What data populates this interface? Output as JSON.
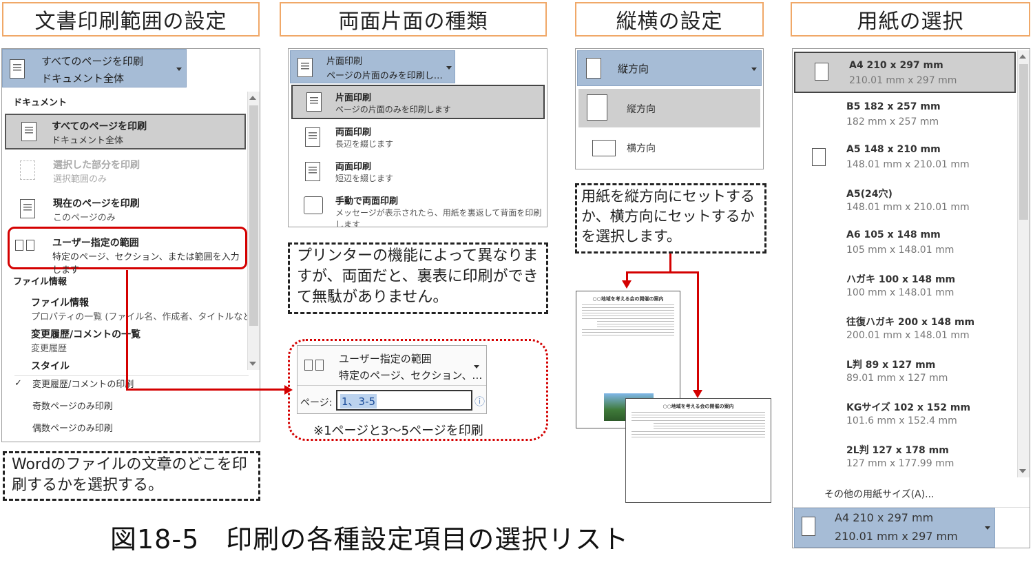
{
  "headers": {
    "h1": "文書印刷範囲の設定",
    "h2": "両面片面の種類",
    "h3": "縦横の設定",
    "h4": "用紙の選択"
  },
  "range_panel": {
    "selected_title": "すべてのページを印刷",
    "selected_sub": "ドキュメント全体",
    "group_document": "ドキュメント",
    "items": [
      {
        "title": "すべてのページを印刷",
        "sub": "ドキュメント全体"
      },
      {
        "title": "選択した部分を印刷",
        "sub": "選択範囲のみ"
      },
      {
        "title": "現在のページを印刷",
        "sub": "このページのみ"
      },
      {
        "title": "ユーザー指定の範囲",
        "sub": "特定のページ、セクション、または範囲を入力します"
      }
    ],
    "group_file": "ファイル情報",
    "file_items": [
      {
        "title": "ファイル情報",
        "sub": "プロパティの一覧 (ファイル名、作成者、タイトルなど)"
      },
      {
        "title": "変更履歴/コメントの一覧",
        "sub": "変更履歴"
      },
      {
        "title": "スタイル",
        "sub": ""
      }
    ],
    "check_items": [
      "変更履歴/コメントの印刷",
      "奇数ページのみ印刷",
      "偶数ページのみ印刷"
    ],
    "check_mark": "✓"
  },
  "range_note": "Wordのファイルの文章のどこを印刷するかを選択する。",
  "duplex_panel": {
    "selected_title": "片面印刷",
    "selected_sub": "ページの片面のみを印刷し…",
    "items": [
      {
        "title": "片面印刷",
        "sub": "ページの片面のみを印刷します"
      },
      {
        "title": "両面印刷",
        "sub": "長辺を綴じます"
      },
      {
        "title": "両面印刷",
        "sub": "短辺を綴じます"
      },
      {
        "title": "手動で両面印刷",
        "sub": "メッセージが表示されたら、用紙を裏返して背面を印刷します"
      }
    ]
  },
  "duplex_note": "プリンターの機能によって異なりますが、両面だと、裏表に印刷ができて無駄がありません。",
  "custom_range": {
    "title": "ユーザー指定の範囲",
    "sub": "特定のページ、セクション、…",
    "pages_label": "ページ:",
    "pages_value": "1、3-5",
    "info_icon": "ⓘ",
    "caption": "※1ページと3～5ページを印刷"
  },
  "orient_panel": {
    "selected": "縦方向",
    "items": [
      "縦方向",
      "横方向"
    ]
  },
  "orient_note": "用紙を縦方向にセットするか、横方向にセットするかを選択します。",
  "doc_preview": {
    "title": "○○地域を考える会の開催の案内"
  },
  "paper_panel": {
    "items": [
      {
        "title": "A4 210 x 297 mm",
        "size": "210.01 mm x 297 mm"
      },
      {
        "title": "B5 182 x 257 mm",
        "size": "182 mm x 257 mm"
      },
      {
        "title": "A5 148 x 210 mm",
        "size": "148.01 mm x 210.01 mm"
      },
      {
        "title": "A5(24穴)",
        "size": "148.01 mm x 210.01 mm"
      },
      {
        "title": "A6 105 x 148 mm",
        "size": "105 mm x 148.01 mm"
      },
      {
        "title": "ハガキ 100 x 148 mm",
        "size": "100 mm x 148.01 mm"
      },
      {
        "title": "往復ハガキ 200 x 148 mm",
        "size": "200.01 mm x 148.01 mm"
      },
      {
        "title": "L判 89 x 127 mm",
        "size": "89.01 mm x 127 mm"
      },
      {
        "title": "KGサイズ 102 x 152 mm",
        "size": "101.6 mm x 152.4 mm"
      },
      {
        "title": "2L判 127 x 178 mm",
        "size": "127 mm x 177.99 mm"
      }
    ],
    "other": "その他の用紙サイズ(A)...",
    "selected_title": "A4 210 x 297 mm",
    "selected_size": "210.01 mm x 297 mm"
  },
  "figure_caption": "図18-5　印刷の各種設定項目の選択リスト",
  "colors": {
    "selection": "#a6bcd6",
    "header_border": "#f0a868",
    "red": "#d40000"
  }
}
